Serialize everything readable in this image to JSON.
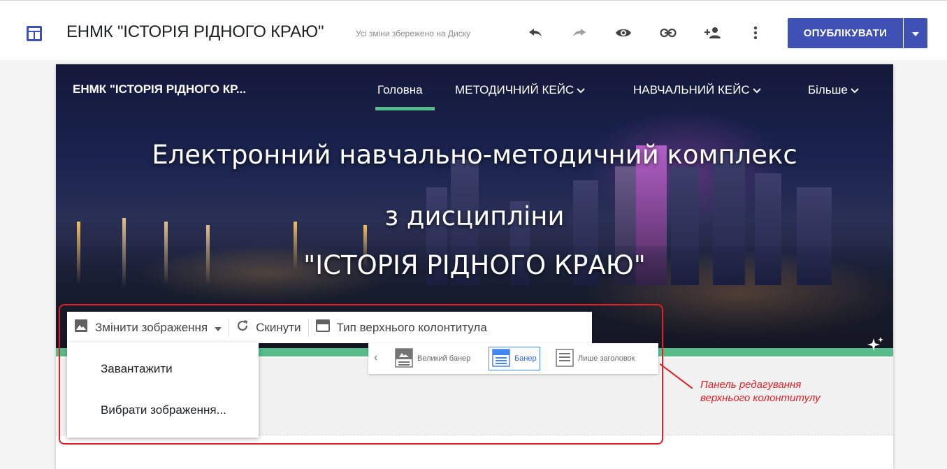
{
  "topbar": {
    "doc_title": "ЕНМК \"ІСТОРІЯ РІДНОГО КРАЮ\"",
    "save_status": "Усі зміни збережено на Диску",
    "icons": [
      "sites-layout-icon",
      "undo-icon",
      "redo-icon",
      "preview-eye-icon",
      "link-icon",
      "share-add-person-icon",
      "more-vert-icon"
    ],
    "publish_label": "ОПУБЛІКУВАТИ",
    "accent_color": "#3f51b5"
  },
  "site": {
    "title": "ЕНМК \"ІСТОРІЯ РІДНОГО КР...",
    "nav": [
      {
        "label": "Головна",
        "active": true,
        "has_dropdown": false
      },
      {
        "label": "МЕТОДИЧНИЙ КЕЙС",
        "active": false,
        "has_dropdown": true
      },
      {
        "label": "НАВЧАЛЬНИЙ КЕЙС",
        "active": false,
        "has_dropdown": true
      },
      {
        "label": "Більше",
        "active": false,
        "has_dropdown": true
      }
    ],
    "nav_underline_color": "#57bb8a"
  },
  "hero": {
    "line1": "Електронний навчально-методичний комплекс",
    "line2": "з дисципліни",
    "line3": "\"ІСТОРІЯ РІДНОГО КРАЮ\""
  },
  "header_editor": {
    "change_image": "Змінити зображення",
    "reset": "Скинути",
    "header_type": "Тип верхнього колонтитула",
    "menu": {
      "upload": "Завантажити",
      "choose": "Вибрати зображення..."
    },
    "types": [
      {
        "label": "Великий банер",
        "selected": false
      },
      {
        "label": "Банер",
        "selected": true
      },
      {
        "label": "Лише заголовок",
        "selected": false
      }
    ]
  },
  "annotation": {
    "line1": "Панель редагування",
    "line2": "верхнього колонтитулу",
    "color": "#e41e26"
  }
}
